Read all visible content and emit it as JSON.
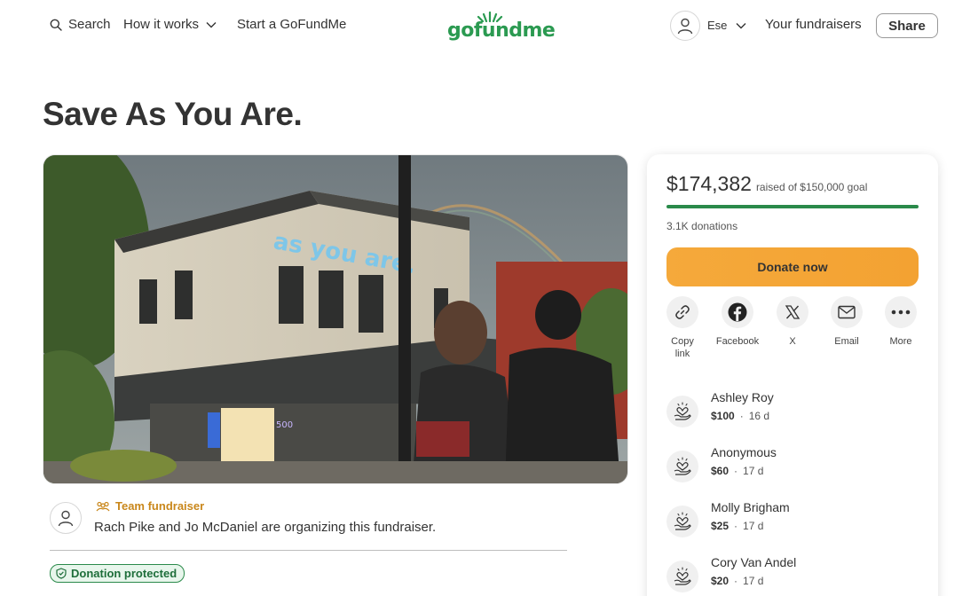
{
  "header": {
    "search_label": "Search",
    "how_it_works_label": "How it works",
    "start_label": "Start a GoFundMe",
    "logo_text": "gofundme",
    "user_name": "Ese",
    "your_fundraisers_label": "Your fundraisers",
    "share_label": "Share"
  },
  "page": {
    "title": "Save As You Are."
  },
  "hero": {
    "sign_text": "as you are.",
    "building_number": "500"
  },
  "organizer": {
    "badge": "Team fundraiser",
    "text": "Rach Pike and Jo McDaniel are organizing this fundraiser."
  },
  "protection": {
    "label": "Donation protected"
  },
  "card": {
    "raised_amount": "$174,382",
    "raised_goal": "raised of $150,000 goal",
    "progress_percent": 100,
    "donations_count": "3.1K donations",
    "donate_label": "Donate now",
    "share_options": [
      {
        "label": "Copy\nlink",
        "icon": "link-icon"
      },
      {
        "label": "Facebook",
        "icon": "facebook-icon"
      },
      {
        "label": "X",
        "icon": "x-icon"
      },
      {
        "label": "Email",
        "icon": "email-icon"
      },
      {
        "label": "More",
        "icon": "more-icon"
      }
    ],
    "donors": [
      {
        "name": "Ashley Roy",
        "amount": "$100",
        "time": "16 d"
      },
      {
        "name": "Anonymous",
        "amount": "$60",
        "time": "17 d"
      },
      {
        "name": "Molly Brigham",
        "amount": "$25",
        "time": "17 d"
      },
      {
        "name": "Cory Van Andel",
        "amount": "$20",
        "time": "17 d"
      }
    ]
  },
  "colors": {
    "brand_green": "#2b9a51",
    "donate_orange": "#f5a93b",
    "team_gold": "#c9871b"
  }
}
